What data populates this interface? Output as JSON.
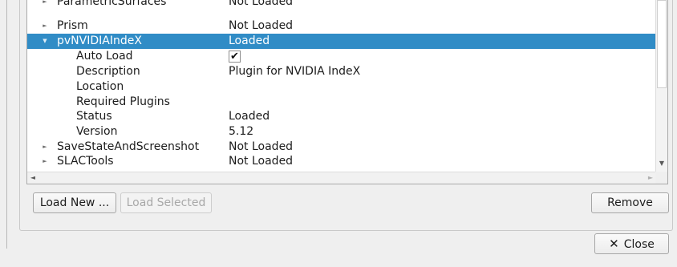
{
  "plugin_tree": {
    "rows": [
      {
        "name": "ParametricSurfaces",
        "value": "Not Loaded",
        "expander": "►"
      },
      {
        "name": "Prism",
        "value": "Not Loaded",
        "expander": "►"
      },
      {
        "name": "pvNVIDIAIndeX",
        "value": "Loaded",
        "expander": "▼"
      },
      {
        "name": "Auto Load",
        "value": "✔"
      },
      {
        "name": "Description",
        "value": "Plugin for NVIDIA IndeX"
      },
      {
        "name": "Location",
        "value": ""
      },
      {
        "name": "Required Plugins",
        "value": ""
      },
      {
        "name": "Status",
        "value": "Loaded"
      },
      {
        "name": "Version",
        "value": "5.12"
      },
      {
        "name": "SaveStateAndScreenshot",
        "value": "Not Loaded",
        "expander": "►"
      },
      {
        "name": "SLACTools",
        "value": "Not Loaded",
        "expander": "►"
      }
    ],
    "selected_row": "pvNVIDIAIndeX",
    "selection_color": "#308cc6",
    "scrollbar": {
      "down_arrow": "▼",
      "left_arrow": "◄",
      "right_arrow": "►"
    }
  },
  "buttons": {
    "load_new": "Load New ...",
    "load_selected": "Load Selected",
    "remove": "Remove",
    "close": "Close",
    "close_icon": "✕"
  }
}
